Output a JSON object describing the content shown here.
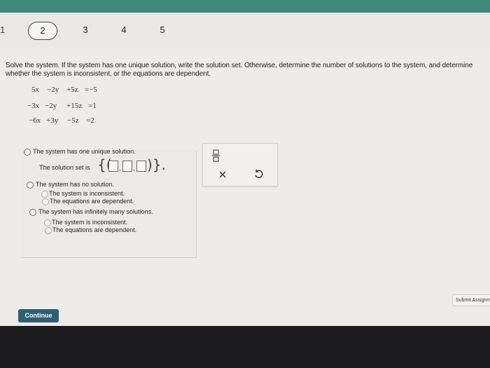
{
  "header": {
    "nav_items": [
      "1",
      "2",
      "3",
      "4",
      "5"
    ],
    "active_item": "2"
  },
  "question": {
    "prompt": "Solve the system. If the system has one unique solution, write the solution set. Otherwise, determine the number of solutions to the system, and determine whether the system is inconsistent, or the equations are dependent.",
    "equations": [
      [
        "5x",
        "−2y",
        "+5z",
        "=−5"
      ],
      [
        "−3x",
        "−2y",
        "+15z",
        "=1"
      ],
      [
        "−6x",
        "+3y",
        "−5z",
        "=2"
      ]
    ]
  },
  "options": {
    "one_solution": "The system has one unique solution.",
    "solution_set_label": "The solution set is",
    "no_solution": "The system has no solution.",
    "no_solution_sub": [
      "The system is inconsistent.",
      "The equations are dependent."
    ],
    "infinite": "The system has infinitely many solutions.",
    "infinite_sub": [
      "The system is inconsistent.",
      "The equations are dependent."
    ]
  },
  "toolbox": {
    "fraction_icon": "fraction-icon",
    "clear_icon": "close-icon",
    "undo_icon": "undo-icon"
  },
  "footer": {
    "continue_label": "Continue",
    "submit_label": "Submit Assignment"
  },
  "colors": {
    "accent_top": "#3f8a7a",
    "continue_bg": "#2f5f73"
  }
}
